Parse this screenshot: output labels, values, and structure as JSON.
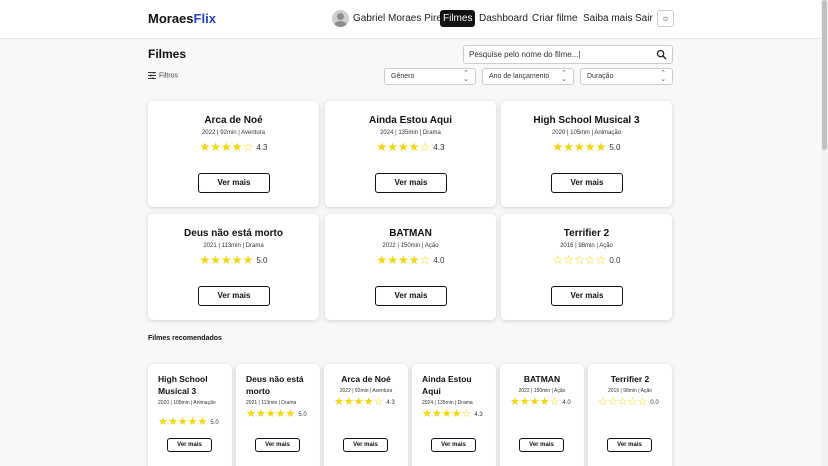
{
  "navbar": {
    "brand_main": "Moraes",
    "brand_accent": "Flix",
    "user_name": "Gabriel Moraes Pires",
    "links": [
      "Filmes",
      "Dashboard",
      "Criar filme",
      "Saiba mais",
      "Sair"
    ],
    "active_link": "Filmes",
    "theme_icon": "sun-icon"
  },
  "page": {
    "title": "Filmes",
    "search_placeholder": "Pesquise pelo nome do filme...|",
    "filters_label": "Filtros",
    "selects": [
      "Gênero",
      "Ano de lançamento",
      "Duração"
    ]
  },
  "movies": [
    {
      "title": "Arca de Noé",
      "meta": "2022 | 92min | Aventura",
      "stars": 4,
      "score": "4.3",
      "button": "Ver mais"
    },
    {
      "title": "Ainda Estou Aqui",
      "meta": "2024 | 135min | Drama",
      "stars": 4,
      "score": "4.3",
      "button": "Ver mais"
    },
    {
      "title": "High School Musical 3",
      "meta": "2020 | 105min | Animação",
      "stars": 5,
      "score": "5.0",
      "button": "Ver mais"
    },
    {
      "title": "Deus não está morto",
      "meta": "2021 | 113min | Drama",
      "stars": 5,
      "score": "5.0",
      "button": "Ver mais"
    },
    {
      "title": "BATMAN",
      "meta": "2022 | 150min | Ação",
      "stars": 4,
      "score": "4.0",
      "button": "Ver mais"
    },
    {
      "title": "Terrifier 2",
      "meta": "2016 | 98min | Ação",
      "stars": 0,
      "score": "0.0",
      "button": "Ver mais"
    }
  ],
  "recommended": {
    "title": "Filmes recomendados",
    "items": [
      {
        "title": "High School Musical 3",
        "meta": "2020 | 105min | Animação",
        "stars": 5,
        "score": "5.0",
        "button": "Ver mais"
      },
      {
        "title": "Deus não está morto",
        "meta": "2021 | 113min | Drama",
        "stars": 5,
        "score": "5.0",
        "button": "Ver mais"
      },
      {
        "title": "Arca de Noé",
        "meta": "2022 | 92min | Aventura",
        "stars": 4,
        "score": "4.3",
        "button": "Ver mais"
      },
      {
        "title": "Ainda Estou Aqui",
        "meta": "2024 | 135min | Drama",
        "stars": 4,
        "score": "4.3",
        "button": "Ver mais"
      },
      {
        "title": "BATMAN",
        "meta": "2022 | 150min | Ação",
        "stars": 4,
        "score": "4.0",
        "button": "Ver mais"
      },
      {
        "title": "Terrifier 2",
        "meta": "2016 | 98min | Ação",
        "stars": 0,
        "score": "0.0",
        "button": "Ver mais"
      }
    ]
  },
  "colors": {
    "accent": "#2a3fd4",
    "star": "#f3d700",
    "active_nav": "#111111"
  }
}
